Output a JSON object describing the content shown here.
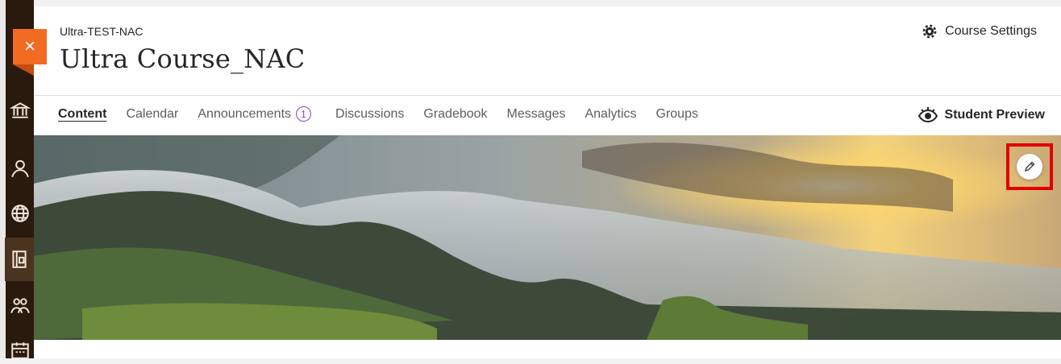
{
  "course": {
    "code": "Ultra-TEST-NAC",
    "title": "Ultra Course_NAC"
  },
  "header": {
    "settings_label": "Course Settings",
    "close_label": "×"
  },
  "tabs": [
    {
      "label": "Content",
      "active": true
    },
    {
      "label": "Calendar"
    },
    {
      "label": "Announcements",
      "badge": "1"
    },
    {
      "label": "Discussions"
    },
    {
      "label": "Gradebook"
    },
    {
      "label": "Messages"
    },
    {
      "label": "Analytics"
    },
    {
      "label": "Groups"
    }
  ],
  "preview": {
    "label": "Student Preview"
  },
  "rail_icons": [
    "institution-icon",
    "profile-icon",
    "globe-icon",
    "courses-icon",
    "groups-icon",
    "calendar-icon"
  ],
  "banner": {
    "edit_icon": "pencil-icon"
  },
  "colors": {
    "accent": "#8f42b5",
    "close_tab": "#f26b23",
    "highlight": "#e30000",
    "rail": "#2a1a0e"
  }
}
